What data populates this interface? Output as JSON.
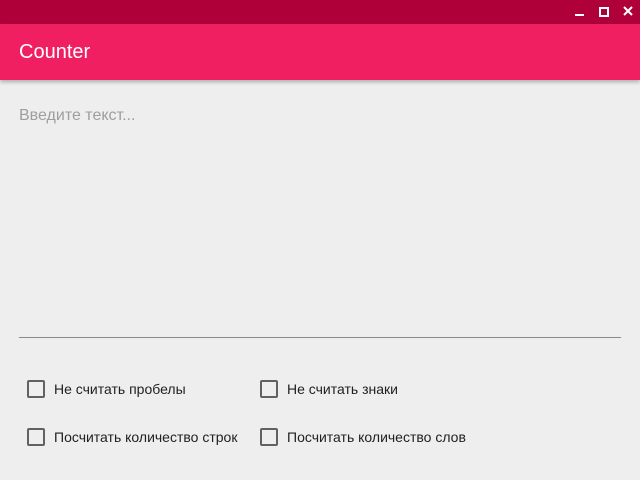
{
  "window": {
    "controls": {
      "minimize_icon": "minimize-icon",
      "maximize_icon": "maximize-icon",
      "close_icon": "close-icon"
    }
  },
  "appbar": {
    "title": "Counter"
  },
  "input": {
    "placeholder": "Введите текст...",
    "value": ""
  },
  "options": [
    {
      "label": "Не считать пробелы",
      "checked": false
    },
    {
      "label": "Не считать знаки",
      "checked": false
    },
    {
      "label": "Посчитать количество строк",
      "checked": false
    },
    {
      "label": "Посчитать количество слов",
      "checked": false
    }
  ],
  "colors": {
    "titlebar": "#b0003a",
    "appbar": "#ef1f62",
    "background": "#eeeeee"
  }
}
